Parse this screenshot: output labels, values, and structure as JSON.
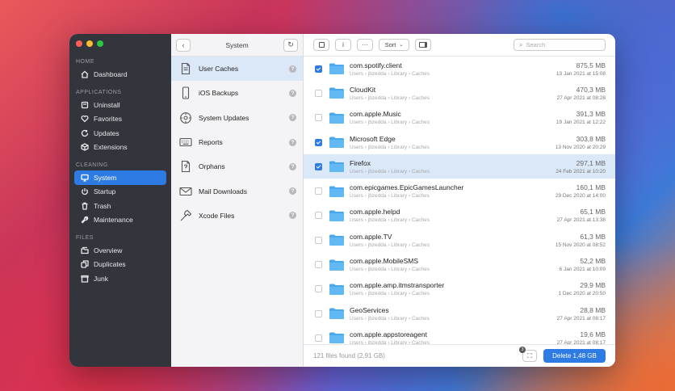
{
  "colors": {
    "accent": "#2f7be4",
    "sidebar_bg": "#33353d",
    "selection": "#dbe8f8",
    "folder": "#4aa8ec"
  },
  "sidebar": {
    "groups": [
      {
        "title": "HOME",
        "items": [
          {
            "label": "Dashboard",
            "icon": "home-icon"
          }
        ]
      },
      {
        "title": "APPLICATIONS",
        "items": [
          {
            "label": "Uninstall",
            "icon": "trash-box-icon"
          },
          {
            "label": "Favorites",
            "icon": "heart-icon"
          },
          {
            "label": "Updates",
            "icon": "refresh-icon"
          },
          {
            "label": "Extensions",
            "icon": "cube-icon"
          }
        ]
      },
      {
        "title": "CLEANING",
        "items": [
          {
            "label": "System",
            "icon": "monitor-icon"
          },
          {
            "label": "Startup",
            "icon": "power-icon"
          },
          {
            "label": "Trash",
            "icon": "trash-icon"
          },
          {
            "label": "Maintenance",
            "icon": "wrench-icon"
          }
        ]
      },
      {
        "title": "FILES",
        "items": [
          {
            "label": "Overview",
            "icon": "folders-icon"
          },
          {
            "label": "Duplicates",
            "icon": "duplicate-icon"
          },
          {
            "label": "Junk",
            "icon": "junk-icon"
          }
        ]
      }
    ]
  },
  "middle": {
    "title": "System",
    "items": [
      {
        "label": "User Caches",
        "icon": "document-icon"
      },
      {
        "label": "iOS Backups",
        "icon": "phone-icon"
      },
      {
        "label": "System Updates",
        "icon": "gear-icon"
      },
      {
        "label": "Reports",
        "icon": "keyboard-icon"
      },
      {
        "label": "Orphans",
        "icon": "question-document-icon"
      },
      {
        "label": "Mail Downloads",
        "icon": "mail-icon"
      },
      {
        "label": "Xcode Files",
        "icon": "hammer-icon"
      }
    ]
  },
  "toolbar": {
    "sort_label": "Sort",
    "search_placeholder": "Search",
    "info_label": "i",
    "more_label": "···"
  },
  "files": [
    {
      "name": "com.spotify.client",
      "path": "Users › jbzedda › Library › Caches",
      "size": "875,5 MB",
      "date": "13 Jan 2021 at 15:08",
      "checked": true
    },
    {
      "name": "CloudKit",
      "path": "Users › jbzedda › Library › Caches",
      "size": "470,3 MB",
      "date": "27 Apr 2021 at 08:28",
      "checked": false
    },
    {
      "name": "com.apple.Music",
      "path": "Users › jbzedda › Library › Caches",
      "size": "391,3 MB",
      "date": "19 Jan 2021 at 12:22",
      "checked": false
    },
    {
      "name": "Microsoft Edge",
      "path": "Users › jbzedda › Library › Caches",
      "size": "303,8 MB",
      "date": "13 Nov 2020 at 20:29",
      "checked": true
    },
    {
      "name": "Firefox",
      "path": "Users › jbzedda › Library › Caches",
      "size": "297,1 MB",
      "date": "24 Feb 2021 at 10:20",
      "checked": true
    },
    {
      "name": "com.epicgames.EpicGamesLauncher",
      "path": "Users › jbzedda › Library › Caches",
      "size": "160,1 MB",
      "date": "29 Dec 2020 at 14:00",
      "checked": false
    },
    {
      "name": "com.apple.helpd",
      "path": "Users › jbzedda › Library › Caches",
      "size": "65,1 MB",
      "date": "27 Apr 2021 at 13:38",
      "checked": false
    },
    {
      "name": "com.apple.TV",
      "path": "Users › jbzedda › Library › Caches",
      "size": "61,3 MB",
      "date": "15 Nov 2020 at 08:52",
      "checked": false
    },
    {
      "name": "com.apple.MobileSMS",
      "path": "Users › jbzedda › Library › Caches",
      "size": "52,2 MB",
      "date": "6 Jan 2021 at 10:09",
      "checked": false
    },
    {
      "name": "com.apple.amp.itmstransporter",
      "path": "Users › jbzedda › Library › Caches",
      "size": "29,9 MB",
      "date": "1 Dec 2020 at 20:50",
      "checked": false
    },
    {
      "name": "GeoServices",
      "path": "Users › jbzedda › Library › Caches",
      "size": "28,8 MB",
      "date": "27 Apr 2021 at 08:17",
      "checked": false
    },
    {
      "name": "com.apple.appstoreagent",
      "path": "Users › jbzedda › Library › Caches",
      "size": "19,6 MB",
      "date": "27 Apr 2021 at 08:17",
      "checked": false
    }
  ],
  "footer": {
    "status": "121 files found (2,91 GB)",
    "badge": "3",
    "delete_label": "Delete 1,48 GB"
  }
}
